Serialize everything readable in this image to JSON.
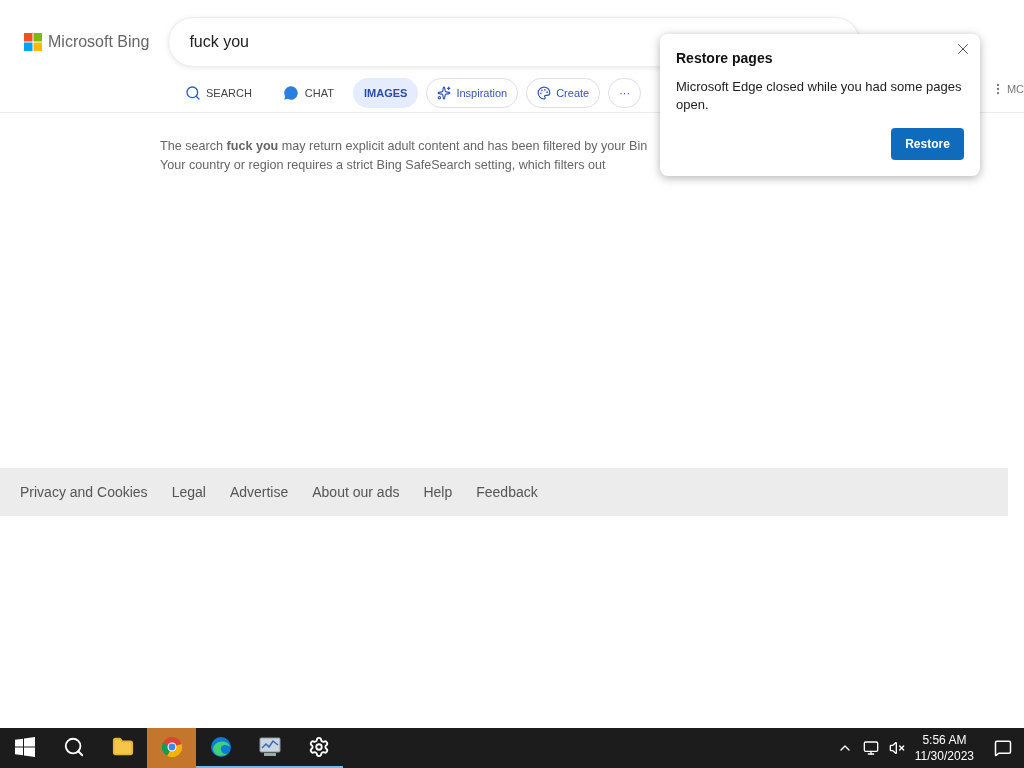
{
  "header": {
    "logo": "Microsoft Bing",
    "search": {
      "value": "fuck you"
    }
  },
  "tabs": [
    {
      "kind": "search",
      "label": "SEARCH",
      "selected": false
    },
    {
      "kind": "chat",
      "label": "CHAT",
      "selected": false
    },
    {
      "kind": "images",
      "label": "IMAGES",
      "selected": true
    },
    {
      "kind": "inspiration",
      "label": "Inspiration",
      "selected": false
    },
    {
      "kind": "create",
      "label": "Create",
      "selected": false
    },
    {
      "kind": "more",
      "label": "···",
      "selected": false
    }
  ],
  "more_menu": {
    "label": "MC"
  },
  "message": [
    "The search **fuck you** may return explicit adult content and has been filtered by your Bin",
    "Your country or region requires a strict Bing SafeSearch setting, which filters out"
  ],
  "footer": {
    "links": [
      "Privacy and Cookies",
      "Legal",
      "Advertise",
      "About our ads",
      "Help",
      "Feedback"
    ]
  },
  "popup": {
    "title": "Restore pages",
    "text": "Microsoft Edge closed while you had some pages open.",
    "button": "Restore"
  },
  "taskbar": {
    "apps": [
      {
        "kind": "start",
        "active": false,
        "running": false
      },
      {
        "kind": "search",
        "active": false,
        "running": false
      },
      {
        "kind": "explorer",
        "active": false,
        "running": false
      },
      {
        "kind": "chrome",
        "active": true,
        "running": false
      },
      {
        "kind": "edge",
        "active": false,
        "running": true
      },
      {
        "kind": "monitor",
        "active": false,
        "running": true
      },
      {
        "kind": "settings",
        "active": false,
        "running": true
      }
    ],
    "time": "5:56 AM",
    "date": "11/30/2023"
  }
}
